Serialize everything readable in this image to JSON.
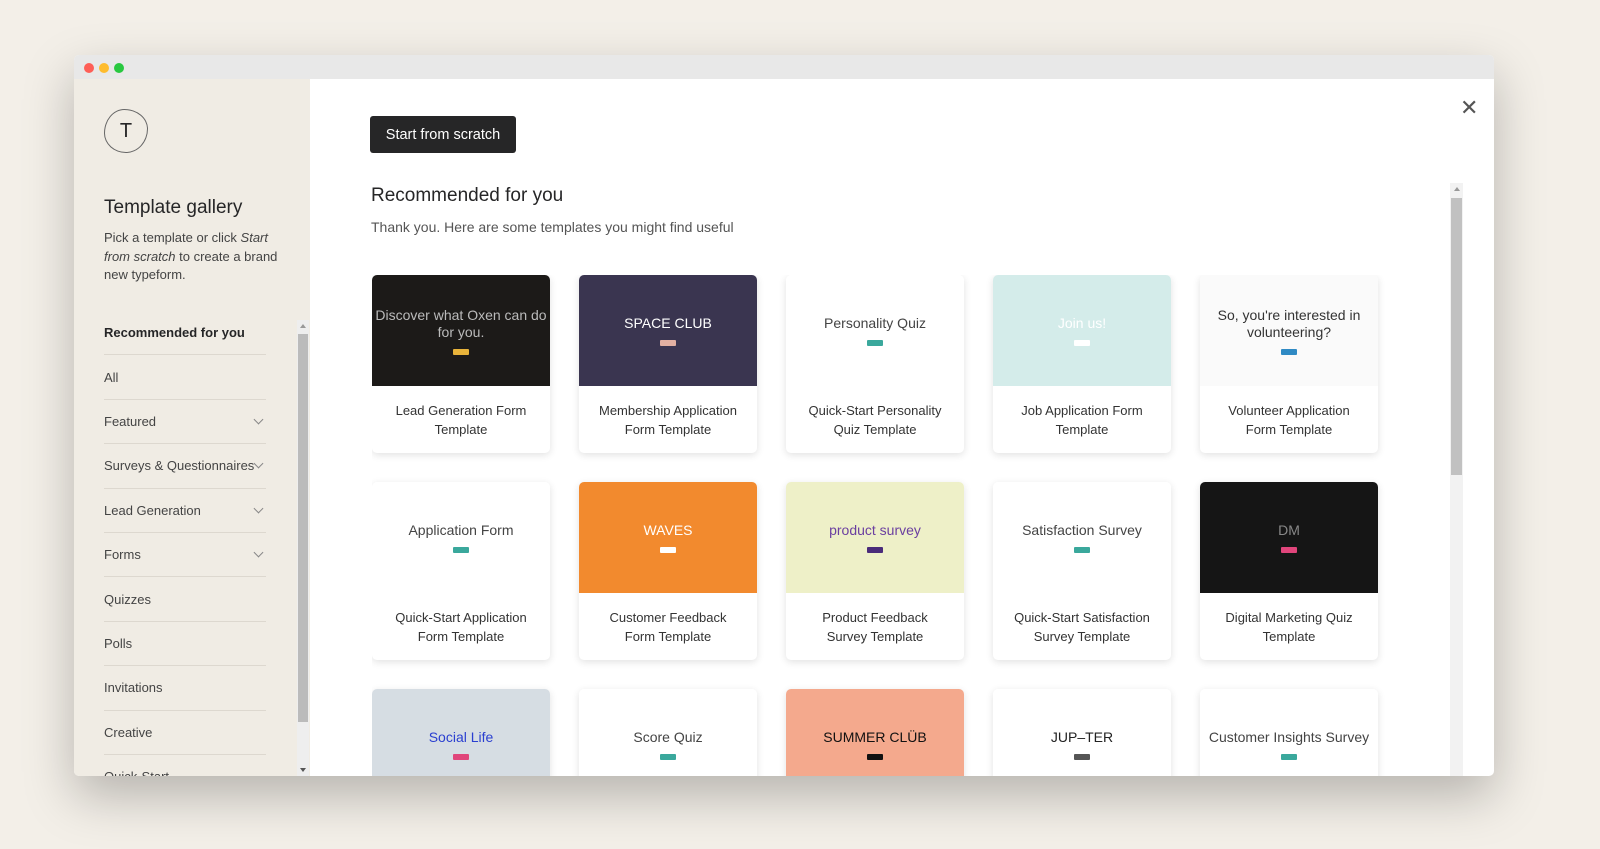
{
  "window": {
    "controls": [
      "close",
      "minimize",
      "maximize"
    ]
  },
  "sidebar": {
    "logo_letter": "T",
    "title": "Template gallery",
    "description_pre": "Pick a template or click ",
    "description_em": "Start from scratch",
    "description_post": " to create a brand new typeform.",
    "items": [
      {
        "label": "Recommended for you",
        "active": true,
        "expandable": false
      },
      {
        "label": "All",
        "expandable": false
      },
      {
        "label": "Featured",
        "expandable": true
      },
      {
        "label": "Surveys & Questionnaires",
        "expandable": true
      },
      {
        "label": "Lead Generation",
        "expandable": true
      },
      {
        "label": "Forms",
        "expandable": true
      },
      {
        "label": "Quizzes",
        "expandable": false
      },
      {
        "label": "Polls",
        "expandable": false
      },
      {
        "label": "Invitations",
        "expandable": false
      },
      {
        "label": "Creative",
        "expandable": false
      },
      {
        "label": "Quick-Start",
        "expandable": false
      }
    ]
  },
  "main": {
    "start_button": "Start from scratch",
    "close_icon": "close-icon",
    "heading": "Recommended for you",
    "subheading": "Thank you. Here are some templates you might find useful",
    "templates": [
      {
        "title": "Lead Generation Form Template",
        "thumb_text": "Discover what Oxen can do for you.",
        "thumb_bg": "#1c1a18",
        "thumb_fg": "#bbb",
        "btn": "#e8b33a"
      },
      {
        "title": "Membership Application Form Template",
        "thumb_text": "SPACE CLUB",
        "thumb_bg": "#3a3550",
        "thumb_fg": "#fff",
        "btn": "#e2b0a2"
      },
      {
        "title": "Quick-Start Personality Quiz Template",
        "thumb_text": "Personality Quiz",
        "thumb_bg": "#ffffff",
        "thumb_fg": "#444",
        "btn": "#3aa89c"
      },
      {
        "title": "Job Application Form Template",
        "thumb_text": "Join us!",
        "thumb_bg": "#d4ecea",
        "thumb_fg": "#fff",
        "btn": "#ffffff"
      },
      {
        "title": "Volunteer Application Form Template",
        "thumb_text": "So, you're interested in volunteering?",
        "thumb_bg": "#fafafa",
        "thumb_fg": "#333",
        "btn": "#2f8ac4"
      },
      {
        "title": "Quick-Start Application Form Template",
        "thumb_text": "Application Form",
        "thumb_bg": "#ffffff",
        "thumb_fg": "#444",
        "btn": "#3aa89c"
      },
      {
        "title": "Customer Feedback Form Template",
        "thumb_text": "WAVES",
        "thumb_bg": "#f28a2e",
        "thumb_fg": "#fff",
        "btn": "#ffffff"
      },
      {
        "title": "Product Feedback Survey Template",
        "thumb_text": "product survey",
        "thumb_bg": "#eef0c8",
        "thumb_fg": "#6b3fa0",
        "btn": "#4a2c7a"
      },
      {
        "title": "Quick-Start Satisfaction Survey Template",
        "thumb_text": "Satisfaction Survey",
        "thumb_bg": "#ffffff",
        "thumb_fg": "#444",
        "btn": "#3aa89c"
      },
      {
        "title": "Digital Marketing Quiz Template",
        "thumb_text": "DM",
        "thumb_bg": "#151515",
        "thumb_fg": "#888",
        "btn": "#e0457b"
      },
      {
        "title": "",
        "thumb_text": "Social Life",
        "thumb_bg": "#d6dde3",
        "thumb_fg": "#2a3fd0",
        "btn": "#e0457b"
      },
      {
        "title": "",
        "thumb_text": "Score Quiz",
        "thumb_bg": "#ffffff",
        "thumb_fg": "#444",
        "btn": "#3aa89c"
      },
      {
        "title": "",
        "thumb_text": "SUMMER CLÜB",
        "thumb_bg": "#f4a98d",
        "thumb_fg": "#111",
        "btn": "#111111"
      },
      {
        "title": "",
        "thumb_text": "JUP–TER",
        "thumb_bg": "#ffffff",
        "thumb_fg": "#222",
        "btn": "#555555"
      },
      {
        "title": "",
        "thumb_text": "Customer Insights Survey",
        "thumb_bg": "#ffffff",
        "thumb_fg": "#444",
        "btn": "#3aa89c"
      }
    ]
  }
}
